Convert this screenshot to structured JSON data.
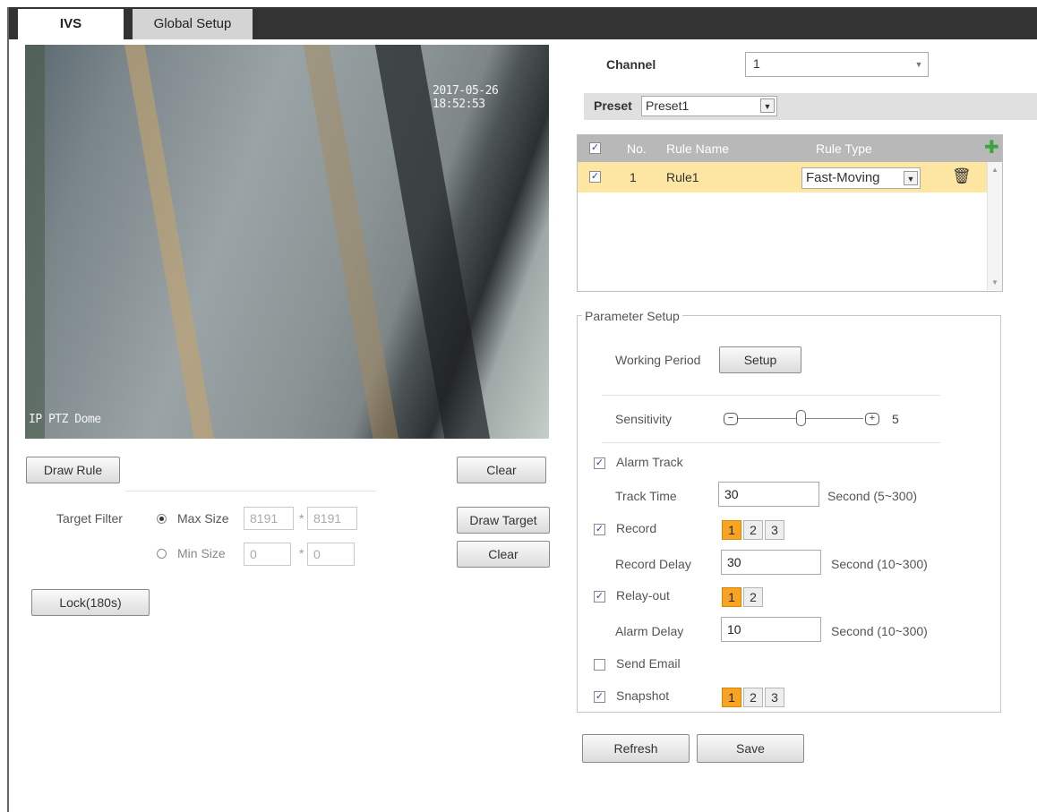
{
  "tabs": [
    {
      "label": "IVS",
      "active": true
    },
    {
      "label": "Global Setup",
      "active": false
    }
  ],
  "video": {
    "timestamp": "2017-05-26 18:52:53",
    "camera_name": "IP PTZ Dome"
  },
  "left_controls": {
    "draw_rule_label": "Draw Rule",
    "clear_label": "Clear",
    "target_filter_label": "Target Filter",
    "max_size_label": "Max Size",
    "max_width": "8191",
    "max_height": "8191",
    "min_size_label": "Min Size",
    "min_width": "0",
    "min_height": "0",
    "times_sign": "*",
    "draw_target_label": "Draw Target",
    "clear_target_label": "Clear",
    "lock_label": "Lock(180s)",
    "selected_size": "Max Size"
  },
  "channel": {
    "label": "Channel",
    "value": "1"
  },
  "preset": {
    "label": "Preset",
    "value": "Preset1"
  },
  "rules_table": {
    "headers": {
      "no": "No.",
      "name": "Rule Name",
      "type": "Rule Type"
    },
    "rows": [
      {
        "checked": true,
        "no": "1",
        "name": "Rule1",
        "type": "Fast-Moving"
      }
    ]
  },
  "parameter_setup": {
    "legend": "Parameter Setup",
    "working_period_label": "Working Period",
    "setup_label": "Setup",
    "sensitivity_label": "Sensitivity",
    "sensitivity_value": "5",
    "sensitivity_max": 10,
    "alarm_track_label": "Alarm Track",
    "alarm_track_checked": true,
    "track_time_label": "Track Time",
    "track_time_value": "30",
    "track_time_range": "Second (5~300)",
    "record_label": "Record",
    "record_checked": true,
    "record_channels": [
      "1",
      "2",
      "3"
    ],
    "record_delay_label": "Record Delay",
    "record_delay_value": "30",
    "record_delay_range": "Second (10~300)",
    "relay_out_label": "Relay-out",
    "relay_out_checked": true,
    "relay_channels": [
      "1",
      "2"
    ],
    "alarm_delay_label": "Alarm Delay",
    "alarm_delay_value": "10",
    "alarm_delay_range": "Second (10~300)",
    "send_email_label": "Send Email",
    "send_email_checked": false,
    "snapshot_label": "Snapshot",
    "snapshot_checked": true,
    "snapshot_channels": [
      "1",
      "2",
      "3"
    ]
  },
  "footer": {
    "refresh_label": "Refresh",
    "save_label": "Save"
  },
  "colors": {
    "tabbar": "#333333",
    "selected_row": "#fde5a2",
    "active_chip": "#f7a425",
    "add_icon": "#3aa63a"
  }
}
